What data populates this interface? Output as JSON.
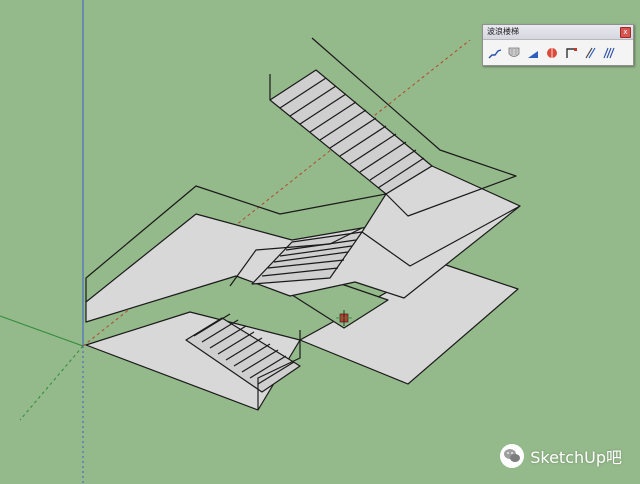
{
  "toolbar": {
    "title": "波浪楼梯",
    "close_label": "x",
    "buttons": [
      {
        "name": "straight-stair-button",
        "icon": "stair-line-icon"
      },
      {
        "name": "shield-tool-button",
        "icon": "shield-icon"
      },
      {
        "name": "ramp-tool-button",
        "icon": "ramp-icon"
      },
      {
        "name": "spiral-tool-button",
        "icon": "spiral-stair-icon"
      },
      {
        "name": "railing-tool-button",
        "icon": "railing-corner-icon"
      },
      {
        "name": "baluster-tool-button",
        "icon": "baluster-icon"
      },
      {
        "name": "multi-rail-tool-button",
        "icon": "parallel-rails-icon"
      }
    ]
  },
  "watermark": {
    "text": "SketchUp吧",
    "icon": "wechat-icon"
  },
  "colors": {
    "background": "#94b98a",
    "surface": "#d8d8d8",
    "edge": "#1a1a1a",
    "axis_red": "#b5472e",
    "axis_green": "#2f8a3a",
    "axis_blue": "#3a5fcf"
  }
}
